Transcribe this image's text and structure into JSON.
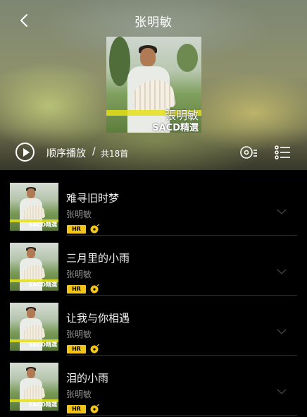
{
  "header": {
    "title": "张明敏",
    "back_icon": "chevron-left-icon",
    "cover": {
      "name_text": "張明敏",
      "series_text": "SACD精選"
    }
  },
  "play_bar": {
    "mode_label": "顺序播放",
    "separator": "/",
    "count_label": "共18首",
    "icons": [
      "play-icon",
      "disc-list-icon",
      "list-menu-icon"
    ]
  },
  "songs": [
    {
      "title": "难寻旧时梦",
      "artist": "张明敏",
      "badge": "HR"
    },
    {
      "title": "三月里的小雨",
      "artist": "张明敏",
      "badge": "HR"
    },
    {
      "title": "让我与你相遇",
      "artist": "张明敏",
      "badge": "HR"
    },
    {
      "title": "泪的小雨",
      "artist": "张明敏",
      "badge": "HR"
    }
  ],
  "colors": {
    "badge": "#f2c417",
    "background": "#000000",
    "artist_text": "#8a8a8a"
  }
}
